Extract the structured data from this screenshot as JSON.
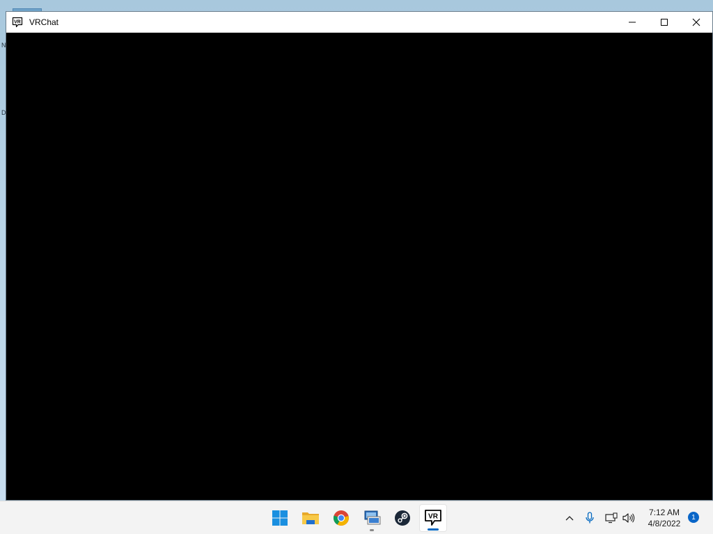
{
  "window": {
    "title": "VRChat",
    "app_icon": "vrchat-icon",
    "controls": [
      "minimize-icon",
      "maximize-icon",
      "close-icon"
    ]
  },
  "desktop": {
    "fragment_1": "N",
    "fragment_2": "D"
  },
  "taskbar": {
    "apps": [
      {
        "name": "Start",
        "icon": "windows-start-icon"
      },
      {
        "name": "File Explorer",
        "icon": "folder-icon"
      },
      {
        "name": "Google Chrome",
        "icon": "chrome-icon"
      },
      {
        "name": "Remote Desktop",
        "icon": "remote-desktop-icon",
        "running": true
      },
      {
        "name": "Steam",
        "icon": "steam-icon"
      },
      {
        "name": "VRChat",
        "icon": "vrchat-icon",
        "active": true
      }
    ],
    "tray": {
      "icons": [
        "chevron-up-icon",
        "microphone-icon",
        "network-icon",
        "speaker-icon"
      ],
      "time": "7:12 AM",
      "date": "4/8/2022",
      "notification_count": "1"
    }
  },
  "colors": {
    "accent": "#0067c0",
    "window_content": "#000000",
    "taskbar": "#f3f3f3"
  }
}
